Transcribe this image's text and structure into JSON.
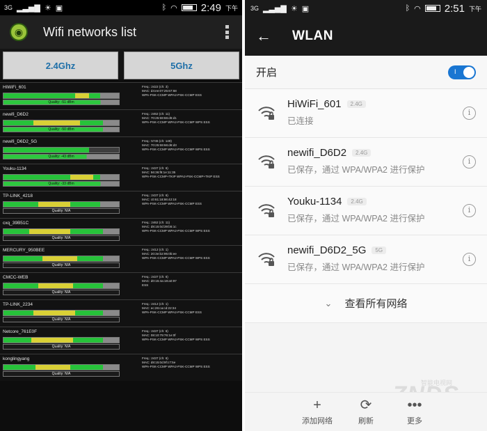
{
  "left": {
    "status_bar": {
      "signal": "3G",
      "time": "2:49",
      "ampm": "下午"
    },
    "app_title": "Wifi networks list",
    "bands": [
      "2.4Ghz",
      "5Ghz"
    ],
    "networks": [
      {
        "ssid": "HiWiFi_601",
        "meter": [
          [
            "green",
            0.62
          ],
          [
            "yellow",
            0.12
          ],
          [
            "green",
            0.1
          ],
          [
            "gray",
            0.16
          ]
        ],
        "quality": "Quality: -51 dBm",
        "quality_filled": 0.84,
        "info": [
          "Freq.: 2422 (ch: 3)",
          "MAC: d4:ee:07:25:67:68",
          "WPA-PSK-CCMP WPA2-PSK-CCMP ESS"
        ]
      },
      {
        "ssid": "newifi_D6D2",
        "meter": [
          [
            "green",
            0.26
          ],
          [
            "yellow",
            0.4
          ],
          [
            "green",
            0.2
          ],
          [
            "gray",
            0.14
          ]
        ],
        "quality": "Quality: -50 dBm",
        "quality_filled": 0.86,
        "info": [
          "Freq.: 2462 (ch: 11)",
          "MAC: 70:25:59:66:d6:d1",
          "WPA-PSK-CCMP WPA2-PSK-CCMP WPS ESS"
        ]
      },
      {
        "ssid": "newifi_D6D2_5G",
        "meter": [
          [
            "green",
            0.74
          ],
          [
            "dark",
            0.26
          ]
        ],
        "quality": "Quality: -43 dBm",
        "quality_filled": 0.72,
        "info": [
          "Freq.: 5745 (ch: 149)",
          "MAC: 70:25:59:66:d6:d3",
          "WPA-PSK-CCMP WPA2-PSK-CCMP WPS ESS"
        ]
      },
      {
        "ssid": "Youku-1134",
        "meter": [
          [
            "green",
            0.58
          ],
          [
            "yellow",
            0.2
          ],
          [
            "green",
            0.06
          ],
          [
            "gray",
            0.16
          ]
        ],
        "quality": "Quality: -33 dBm",
        "quality_filled": 0.84,
        "info": [
          "Freq.: 2437 (ch: 6)",
          "MAC: 56:36:f8:1e:11:35",
          "WPA-PSK-CCMP+TKIP WPA2-PSK-CCMP+TKIP ESS"
        ]
      },
      {
        "ssid": "TP-LINK_4218",
        "meter": [
          [
            "green",
            0.3
          ],
          [
            "yellow",
            0.28
          ],
          [
            "green",
            0.26
          ],
          [
            "gray",
            0.16
          ]
        ],
        "quality": "Quality: N/A",
        "quality_filled": 0,
        "info": [
          "Freq.: 2437 (ch: 6)",
          "MAC: c0:61:18:86:42:18",
          "WPA-PSK-CCMP WPA2-PSK-CCMP ESS"
        ]
      },
      {
        "ssid": "cxq_39B51C",
        "meter": [
          [
            "green",
            0.22
          ],
          [
            "yellow",
            0.36
          ],
          [
            "green",
            0.28
          ],
          [
            "gray",
            0.14
          ]
        ],
        "quality": "Quality: N/A",
        "quality_filled": 0,
        "info": [
          "Freq.: 2462 (ch: 11)",
          "MAC: d8:15:0d:39:b5:1c",
          "WPA-PSK-CCMP WPA2-PSK-CCMP WPS ESS"
        ]
      },
      {
        "ssid": "MERCURY_950BEE",
        "meter": [
          [
            "green",
            0.34
          ],
          [
            "yellow",
            0.3
          ],
          [
            "green",
            0.22
          ],
          [
            "gray",
            0.14
          ]
        ],
        "quality": "Quality: N/A",
        "quality_filled": 0,
        "info": [
          "Freq.: 2412 (ch: 1)",
          "MAC: 20:3e:b2:95:0b:ee",
          "WPA-PSK-CCMP WPA2-PSK-CCMP WPS ESS"
        ]
      },
      {
        "ssid": "CMCC-WEB",
        "meter": [
          [
            "green",
            0.3
          ],
          [
            "yellow",
            0.3
          ],
          [
            "green",
            0.26
          ],
          [
            "gray",
            0.14
          ]
        ],
        "quality": "Quality: N/A",
        "quality_filled": 0,
        "info": [
          "Freq.: 2437 (ch: 6)",
          "MAC: d0:15:4a:18:a0:97",
          "ESS"
        ]
      },
      {
        "ssid": "TP-LINK_2234",
        "meter": [
          [
            "green",
            0.26
          ],
          [
            "yellow",
            0.36
          ],
          [
            "green",
            0.24
          ],
          [
            "gray",
            0.14
          ]
        ],
        "quality": "Quality: N/A",
        "quality_filled": 0,
        "info": [
          "Freq.: 2412 (ch: 1)",
          "MAC: ec:26:ca:cd:22:34",
          "WPA-PSK-CCMP WPA2-PSK-CCMP ESS"
        ]
      },
      {
        "ssid": "Netcore_761E0F",
        "meter": [
          [
            "green",
            0.24
          ],
          [
            "yellow",
            0.36
          ],
          [
            "green",
            0.26
          ],
          [
            "gray",
            0.14
          ]
        ],
        "quality": "Quality: N/A",
        "quality_filled": 0,
        "info": [
          "Freq.: 2437 (ch: 6)",
          "MAC: 08:10:79:76:1e:0f",
          "WPA-PSK-CCMP WPA2-PSK-CCMP WPS ESS"
        ]
      },
      {
        "ssid": "konglingyang",
        "meter": [
          [
            "green",
            0.28
          ],
          [
            "yellow",
            0.3
          ],
          [
            "green",
            0.28
          ],
          [
            "gray",
            0.14
          ]
        ],
        "quality": "Quality: N/A",
        "quality_filled": 0,
        "info": [
          "Freq.: 2437 (ch: 6)",
          "MAC: d8:15:0d:9f:c7:5e",
          "WPA-PSK-CCMP WPA2-PSK-CCMP WPS ESS"
        ]
      }
    ]
  },
  "right": {
    "status_bar": {
      "signal": "3G",
      "time": "2:51",
      "ampm": "下午"
    },
    "title": "WLAN",
    "toggle_label": "开启",
    "toggle_state": "I",
    "access_points": [
      {
        "name": "HiWiFi_601",
        "band": "2.4G",
        "status": "已连接"
      },
      {
        "name": "newifi_D6D2",
        "band": "2.4G",
        "status": "已保存，通过 WPA/WPA2 进行保护"
      },
      {
        "name": "Youku-1134",
        "band": "2.4G",
        "status": "已保存，通过 WPA/WPA2 进行保护"
      },
      {
        "name": "newifi_D6D2_5G",
        "band": "5G",
        "status": "已保存，通过 WPA/WPA2 进行保护"
      }
    ],
    "see_all": "查看所有网络",
    "bottom": [
      {
        "icon": "plus-icon",
        "glyph": "+",
        "label": "添加网络"
      },
      {
        "icon": "refresh-icon",
        "glyph": "⟳",
        "label": "刷新"
      },
      {
        "icon": "more-icon",
        "glyph": "•••",
        "label": "更多"
      }
    ],
    "watermark": "ZNDS",
    "watermark_small": "智能电视网",
    "accent": "#1976d2"
  }
}
